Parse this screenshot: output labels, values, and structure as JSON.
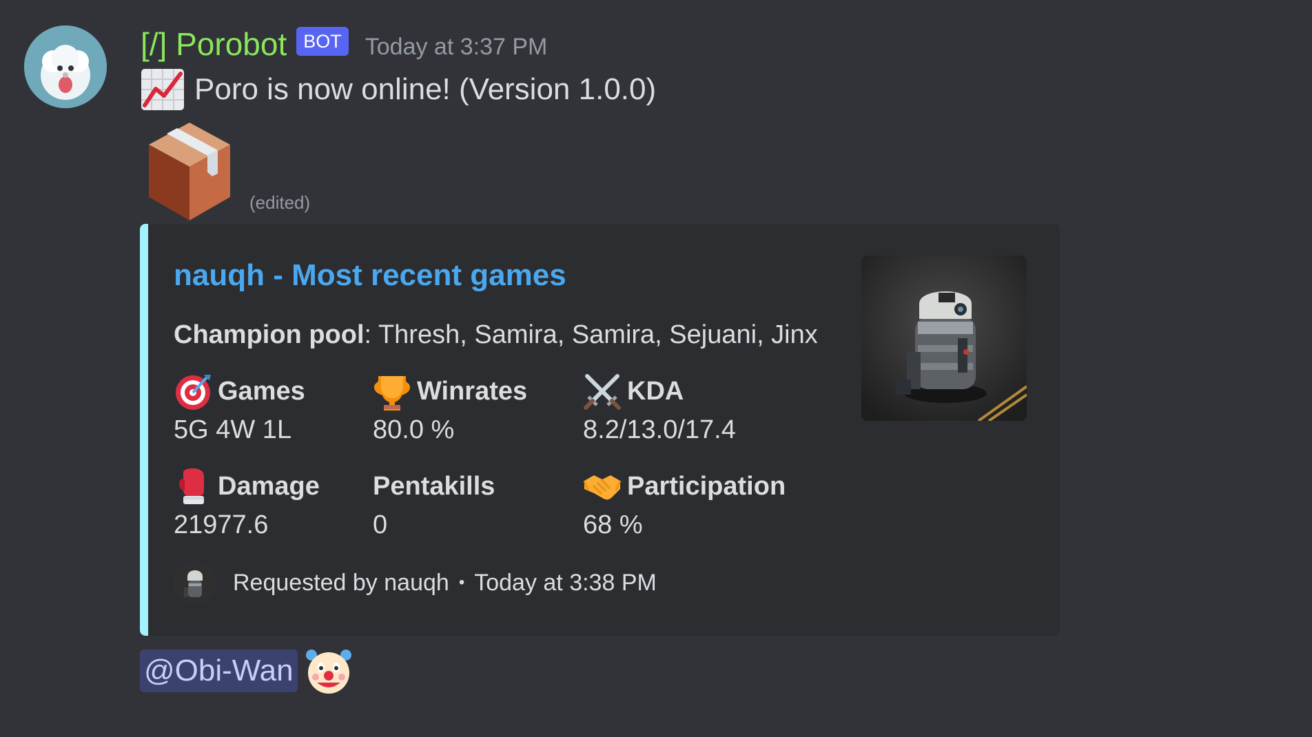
{
  "message": {
    "author": "[/] Porobot",
    "bot_tag": "BOT",
    "timestamp": "Today at 3:37 PM",
    "content": "Poro is now online! (Version 1.0.0)",
    "edited_label": "(edited)"
  },
  "embed": {
    "accent_color": "#a3f0ff",
    "title": "nauqh - Most recent games",
    "description_label": "Champion pool",
    "description_value": ": Thresh, Samira, Samira, Sejuani, Jinx",
    "fields": [
      {
        "icon": "target-icon",
        "name": "Games",
        "value": "5G 4W 1L"
      },
      {
        "icon": "trophy-icon",
        "name": "Winrates",
        "value": "80.0 %"
      },
      {
        "icon": "crossed-swords-icon",
        "name": "KDA",
        "value": "8.2/13.0/17.4"
      },
      {
        "icon": "boxing-glove-icon",
        "name": "Damage",
        "value": "21977.6"
      },
      {
        "icon": "",
        "name": "Pentakills",
        "value": "0"
      },
      {
        "icon": "handshake-icon",
        "name": "Participation",
        "value": "68 %"
      }
    ],
    "footer": {
      "text": "Requested by nauqh",
      "separator": "•",
      "timestamp": "Today at 3:38 PM"
    }
  },
  "mention": {
    "label": "@Obi-Wan"
  },
  "colors": {
    "background": "#313338",
    "embed_background": "#2b2d31",
    "username": "#8ae65c",
    "link": "#4aa8f0",
    "bot_tag": "#5865f2",
    "mention_bg": "#3c4270"
  }
}
